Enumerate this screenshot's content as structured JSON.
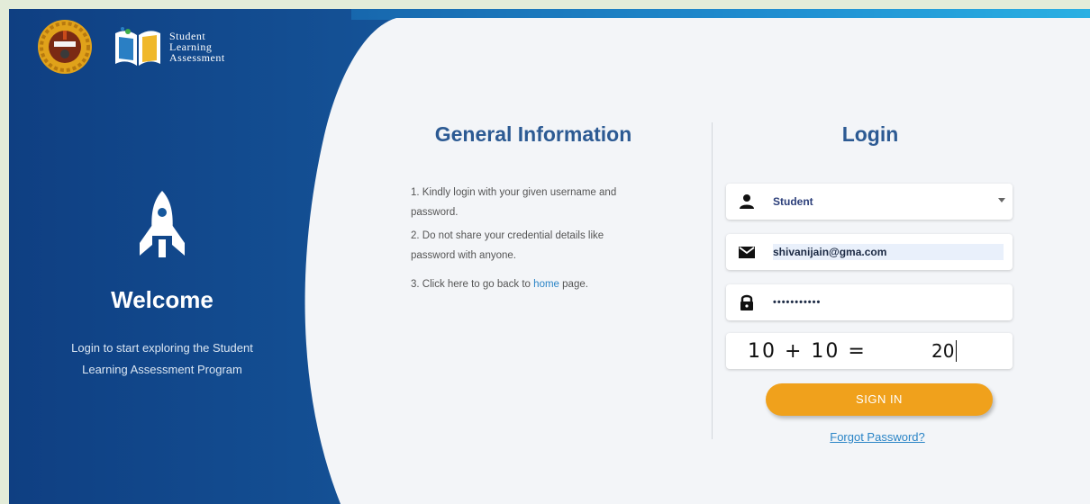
{
  "header": {
    "logo_line1": "Student",
    "logo_line2": "Learning",
    "logo_line3": "Assessment"
  },
  "welcome": {
    "title": "Welcome",
    "subtitle_line1": "Login to start exploring the Student",
    "subtitle_line2": "Learning Assessment Program"
  },
  "general_info": {
    "title": "General Information",
    "item1_line1": "1. Kindly login with your given username and",
    "item1_line2": "password.",
    "item2_line1": "2. Do not share your credential details like",
    "item2_line2": "password with anyone.",
    "item3_prefix": "3. Click here to go back to",
    "item3_link": "home",
    "item3_suffix": "page."
  },
  "login": {
    "title": "Login",
    "role_value": "Student",
    "email_value": "shivanijain@gma.com",
    "password_mask": "•••••••••••",
    "captcha_question": "10 + 10 =",
    "captcha_answer": "20",
    "signin_label": "SIGN IN",
    "forgot_label": "Forgot Password?"
  },
  "colors": {
    "brand_blue": "#16589d",
    "heading_blue": "#2c5a93",
    "accent_orange": "#f0a11c",
    "link_blue": "#2a84c6"
  },
  "icons": {
    "emblem": "state-emblem-icon",
    "book": "book-logo-icon",
    "rocket": "rocket-icon",
    "user": "user-icon",
    "mail": "mail-icon",
    "lock": "lock-icon",
    "dropdown": "chevron-down-icon"
  }
}
